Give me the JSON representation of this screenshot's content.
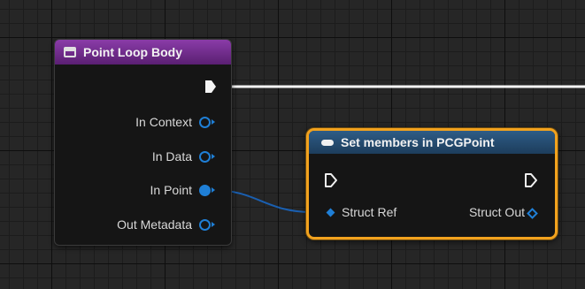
{
  "point_loop_node": {
    "title": "Point Loop Body",
    "pins": [
      {
        "label": "In Context",
        "connected": false
      },
      {
        "label": "In Data",
        "connected": false
      },
      {
        "label": "In Point",
        "connected": true
      },
      {
        "label": "Out Metadata",
        "connected": false
      }
    ]
  },
  "set_members_node": {
    "title": "Set members in PCGPoint",
    "input_pin": "Struct Ref",
    "output_pin": "Struct Out"
  },
  "colors": {
    "loop_header": "#7a2e98",
    "set_header": "#2e5c86",
    "selection_outline": "#f2a21e",
    "pin_blue": "#1f7fd6",
    "wire_white": "#ffffff"
  }
}
